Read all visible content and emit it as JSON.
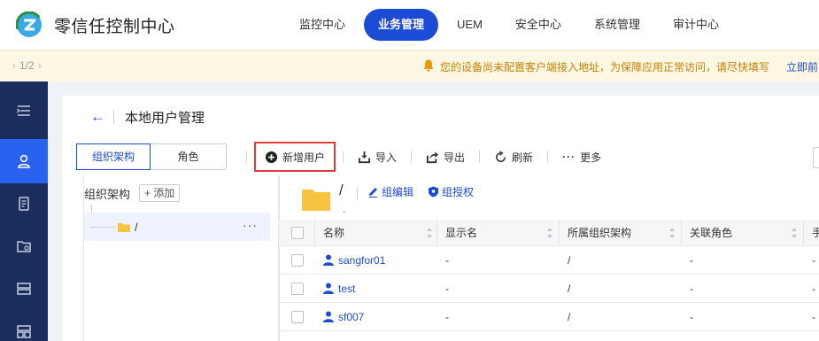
{
  "header": {
    "app_title": "零信任控制中心",
    "nav": [
      {
        "label": "监控中心"
      },
      {
        "label": "业务管理",
        "active": true
      },
      {
        "label": "UEM"
      },
      {
        "label": "安全中心"
      },
      {
        "label": "系统管理"
      },
      {
        "label": "审计中心"
      }
    ]
  },
  "notice": {
    "pager": "1/2",
    "text": "您的设备尚未配置客户端接入地址，为保障应用正常访问，请尽快填写",
    "link": "立即前"
  },
  "sidebar": {
    "icons": [
      "menu-collapse-icon",
      "user-icon",
      "document-icon",
      "folder-settings-icon",
      "server-icon",
      "dashboard-icon"
    ],
    "active_index": 1
  },
  "page": {
    "title": "本地用户管理"
  },
  "segments": {
    "org": "组织架构",
    "role": "角色"
  },
  "toolbar": {
    "add_user": "新增用户",
    "import": "导入",
    "export": "导出",
    "refresh": "刷新",
    "more": "更多"
  },
  "tree": {
    "label": "组织架构",
    "add": "+ 添加",
    "root_name": "/",
    "more": "···"
  },
  "group": {
    "name": "/",
    "sub": "-",
    "edit": "组编辑",
    "grant": "组授权"
  },
  "table": {
    "columns": {
      "name": "名称",
      "display": "显示名",
      "org": "所属组织架构",
      "role": "关联角色",
      "extra": "手"
    },
    "rows": [
      {
        "name": "sangfor01",
        "display": "-",
        "org": "/",
        "role": "-",
        "extra": "-"
      },
      {
        "name": "test",
        "display": "-",
        "org": "/",
        "role": "-",
        "extra": "-"
      },
      {
        "name": "sf007",
        "display": "-",
        "org": "/",
        "role": "-",
        "extra": "-"
      }
    ]
  },
  "colors": {
    "brand": "#1c4bd6",
    "sidebar": "#1b2d5c",
    "sidebar_active": "#2a62f0",
    "notice_bg": "#fdf7e4",
    "notice_text": "#c58200",
    "highlight_border": "#e13b3b",
    "folder": "#f8c33e"
  }
}
